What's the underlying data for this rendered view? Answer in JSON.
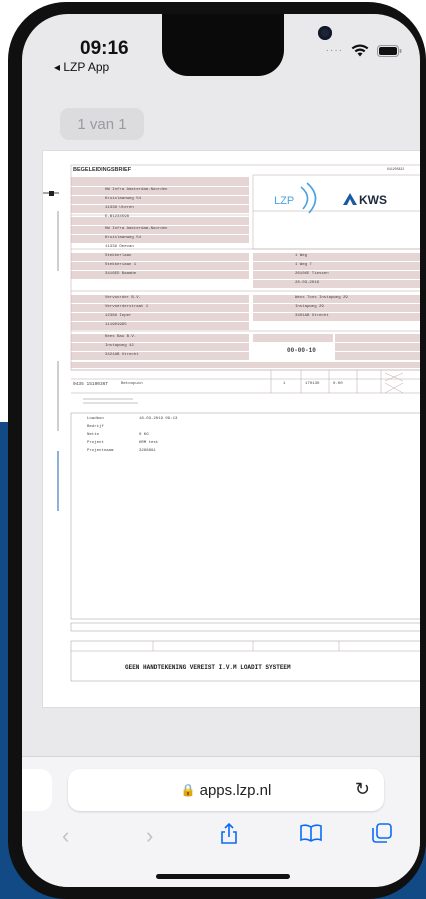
{
  "status_bar": {
    "time": "09:16",
    "back_app": "LZP App"
  },
  "page_indicator": "1 van 1",
  "document": {
    "title": "BEGELEIDINGSBRIEF",
    "doc_number": "641205822",
    "brand_lzp": "LZP",
    "brand_kws": "KWS",
    "sender_name": "HW Infra Amsterdam-Noorden",
    "sender_address": "Kruislaanweg 54",
    "sender_postal": "11339 Uteren",
    "sender_id": "E.B1234598",
    "receiver_name": "HW Infra Amsterdam-Noorden",
    "receiver_address": "Kruislaanweg 54",
    "receiver_postal": "11339 Deevan",
    "location_name": "Stekkerlaan",
    "location_address": "Stekkeriaan 1",
    "location_postal": "3416ED Baamhe",
    "location_right_1": "1 Weg",
    "location_right_2": "1 Weg 7",
    "location_right_3": "2610XE Tiessen",
    "location_right_4": "28-03-2019",
    "transporter_name": "Vervoorder B.V.",
    "transporter_address": "Vervoerderstraat 1",
    "transporter_postal": "12389 Ieper",
    "transporter_id": "111901995",
    "processor_name": "Wess Tons Instapweg 29",
    "processor_address": "Instapweg 29",
    "processor_postal": "3401AB Utrecht",
    "buyer_name": "Kees Bau B.V.",
    "buyer_address": "Instapweg 42",
    "buyer_postal": "3421AB Utrecht",
    "receive_date": "00-00-10",
    "material_code": "0435 1510036T",
    "material_desc": "Betonpuin",
    "quantity": "1",
    "weight": "170130",
    "weight2": "0.00",
    "detail_labels": [
      "Loadbon",
      "Bedrijf",
      "Netto",
      "Project",
      "Projectnaam"
    ],
    "detail_values": [
      "18-03-2019 09:13",
      "",
      "0 KG",
      "HRM test",
      "3288891"
    ],
    "no_signature_text": "GEEN HANDTEKENING VEREIST I.V.M LOADIT SYSTEEM"
  },
  "browser": {
    "url": "apps.lzp.nl"
  },
  "colors": {
    "background_panel": "#114a84",
    "safari_accent": "#0a6cf5"
  },
  "icons": [
    "back-arrow-icon",
    "forward-arrow-icon",
    "share-icon",
    "bookmarks-icon",
    "tabs-icon",
    "reload-icon",
    "lock-icon",
    "wifi-icon",
    "battery-icon"
  ]
}
